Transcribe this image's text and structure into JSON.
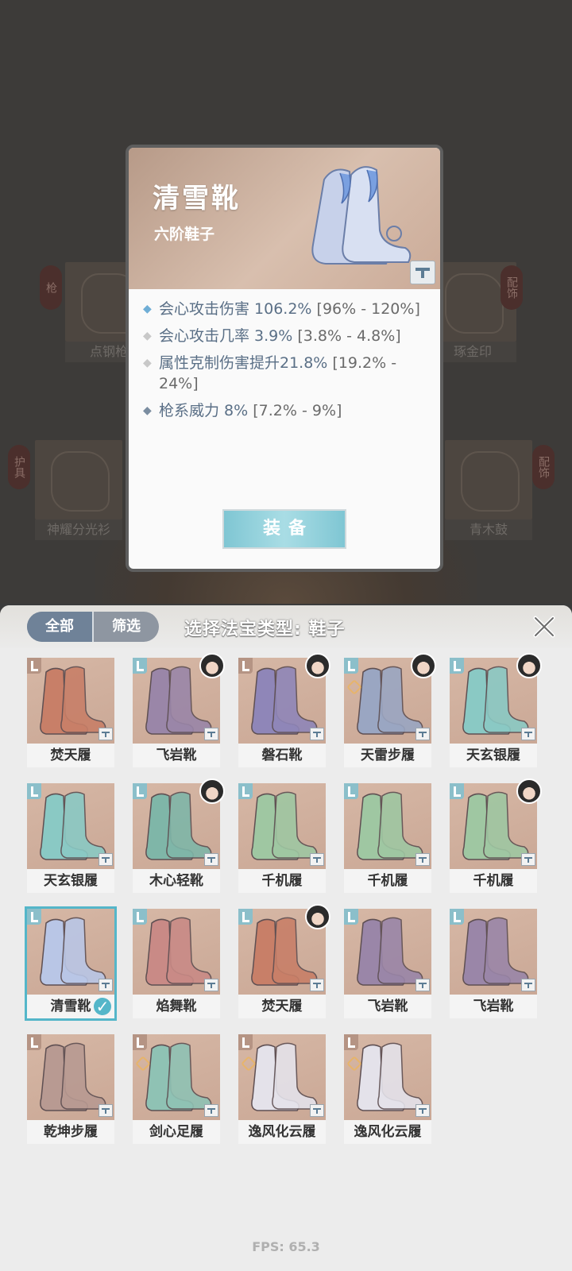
{
  "background_items": [
    {
      "name": "点钢枪",
      "tag": "枪"
    },
    {
      "name": "琢金印",
      "tag": "配饰"
    },
    {
      "name": "神耀分光衫",
      "tag": "护具"
    },
    {
      "name": "青木鼓",
      "tag": "配饰"
    }
  ],
  "detail": {
    "title": "清雪靴",
    "subtitle": "六阶鞋子",
    "stats": [
      {
        "value": "会心攻击伤害 106.2%",
        "range": "[96% - 120%]"
      },
      {
        "value": "会心攻击几率 3.9%",
        "range": "[3.8% - 4.8%]"
      },
      {
        "value": "属性克制伤害提升21.8%",
        "range": "[19.2% - 24%]"
      },
      {
        "value": "枪系威力 8%",
        "range": "[7.2% - 9%]"
      }
    ],
    "equip_label": "装备"
  },
  "panel": {
    "tabs": [
      "全部",
      "筛选"
    ],
    "title": "选择法宝类型: 鞋子"
  },
  "items": [
    {
      "name": "焚天履",
      "color": "#c87f68"
    },
    {
      "name": "飞岩靴",
      "color": "#9a86a8"
    },
    {
      "name": "磐石靴",
      "color": "#8f86b8"
    },
    {
      "name": "天雷步履",
      "color": "#9aa6c2"
    },
    {
      "name": "天玄银履",
      "color": "#8ac9c4"
    },
    {
      "name": "天玄银履",
      "color": "#8ac9c4"
    },
    {
      "name": "木心轻靴",
      "color": "#7fb6a8"
    },
    {
      "name": "千机履",
      "color": "#9fc7a2"
    },
    {
      "name": "千机履",
      "color": "#9fc7a2"
    },
    {
      "name": "千机履",
      "color": "#9fc7a2"
    },
    {
      "name": "清雪靴",
      "color": "#b9c6e6"
    },
    {
      "name": "焰舞靴",
      "color": "#c98a86"
    },
    {
      "name": "焚天履",
      "color": "#c87f68"
    },
    {
      "name": "飞岩靴",
      "color": "#9a86a8"
    },
    {
      "name": "飞岩靴",
      "color": "#9a86a8"
    },
    {
      "name": "乾坤步履",
      "color": "#b89a92"
    },
    {
      "name": "剑心足履",
      "color": "#8fc2b4"
    },
    {
      "name": "逸风化云履",
      "color": "#e4e2ea"
    },
    {
      "name": "逸风化云履",
      "color": "#e4e2ea"
    }
  ],
  "fps": "FPS: 65.3"
}
